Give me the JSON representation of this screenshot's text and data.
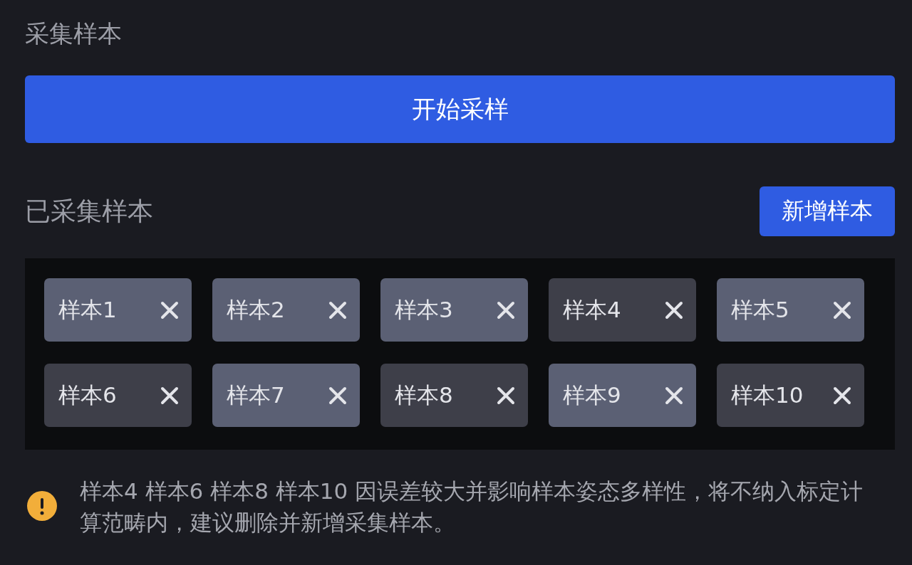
{
  "capture": {
    "title": "采集样本",
    "start_button": "开始采样"
  },
  "collected": {
    "title": "已采集样本",
    "add_button": "新增样本"
  },
  "samples": [
    {
      "label": "样本1",
      "flagged": false
    },
    {
      "label": "样本2",
      "flagged": false
    },
    {
      "label": "样本3",
      "flagged": false
    },
    {
      "label": "样本4",
      "flagged": true
    },
    {
      "label": "样本5",
      "flagged": false
    },
    {
      "label": "样本6",
      "flagged": true
    },
    {
      "label": "样本7",
      "flagged": false
    },
    {
      "label": "样本8",
      "flagged": true
    },
    {
      "label": "样本9",
      "flagged": false
    },
    {
      "label": "样本10",
      "flagged": true
    }
  ],
  "warning": {
    "text": "样本4 样本6 样本8 样本10 因误差较大并影响样本姿态多样性，将不纳入标定计算范畴内，建议删除并新增采集样本。"
  }
}
